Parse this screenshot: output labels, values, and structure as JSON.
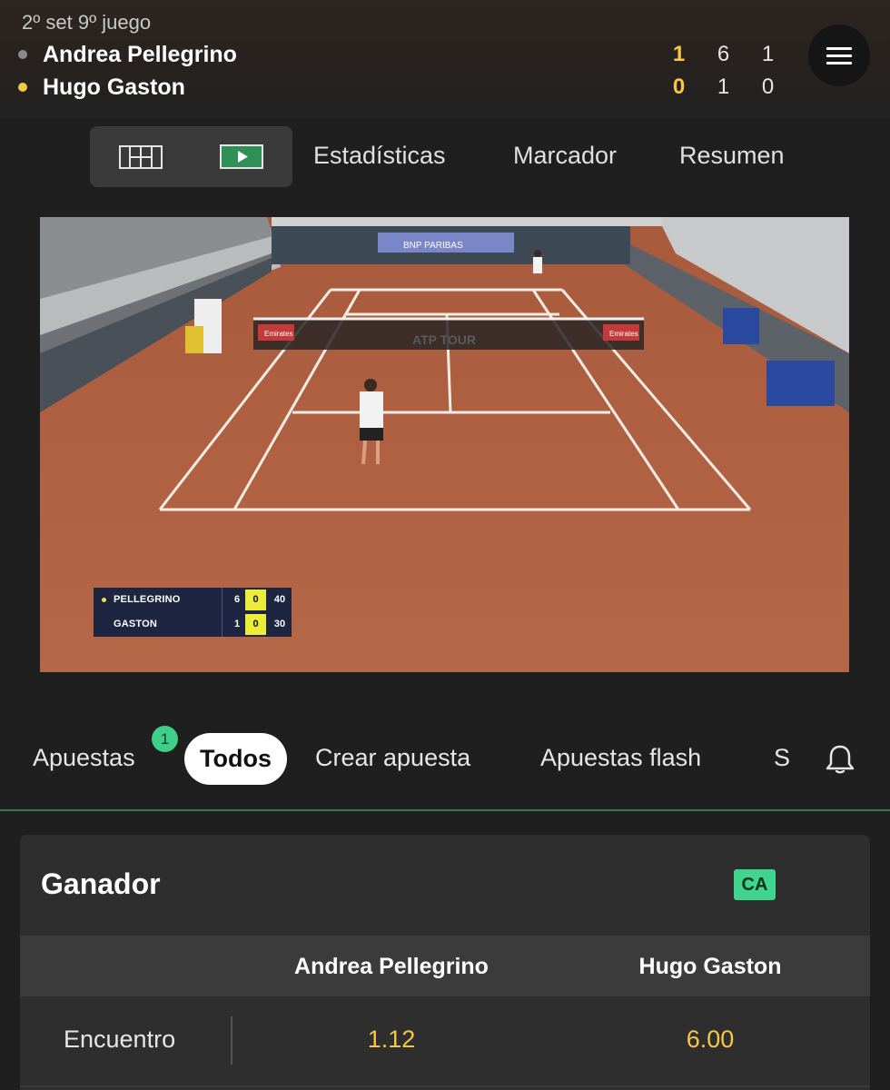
{
  "header": {
    "set_info": "2º set 9º juego",
    "players": [
      {
        "name": "Andrea Pellegrino",
        "serving": false,
        "dot_color": "#8a8a8a",
        "scores": [
          "1",
          "6",
          "1"
        ]
      },
      {
        "name": "Hugo Gaston",
        "serving": true,
        "dot_color": "#f6c744",
        "scores": [
          "0",
          "1",
          "0"
        ]
      }
    ],
    "menu_icon": "hamburger-menu-icon"
  },
  "top_tabs": {
    "grid_icon": "court-grid-icon",
    "video_icon": "play-video-icon",
    "items": [
      "Estadísticas",
      "Marcador",
      "Resumen"
    ]
  },
  "video": {
    "overlay": {
      "rows": [
        {
          "name": "PELLEGRINO",
          "set": "6",
          "game": "0",
          "points": "40",
          "serving": true
        },
        {
          "name": "GASTON",
          "set": "1",
          "game": "0",
          "points": "30",
          "serving": false
        }
      ]
    },
    "court_banners": {
      "sponsor_center": "BNP PARIBAS",
      "net_label": "ATP TOUR",
      "net_left": "Emirates",
      "net_right": "Emirates"
    }
  },
  "bet_tabs": {
    "items": [
      "Apuestas",
      "Todos",
      "Crear apuesta",
      "Apuestas flash",
      "S"
    ],
    "active": "Todos",
    "badge_count": "1",
    "bell_icon": "bell-icon"
  },
  "market": {
    "title": "Ganador",
    "badge": "CA",
    "columns": [
      "Andrea Pellegrino",
      "Hugo Gaston"
    ],
    "rows": [
      {
        "label": "Encuentro",
        "odds": [
          "1.12",
          "6.00"
        ]
      }
    ]
  },
  "colors": {
    "accent_yellow": "#f6c744",
    "accent_green": "#3fd58e",
    "background": "#1f1f1f",
    "card": "#2e2e2e"
  }
}
